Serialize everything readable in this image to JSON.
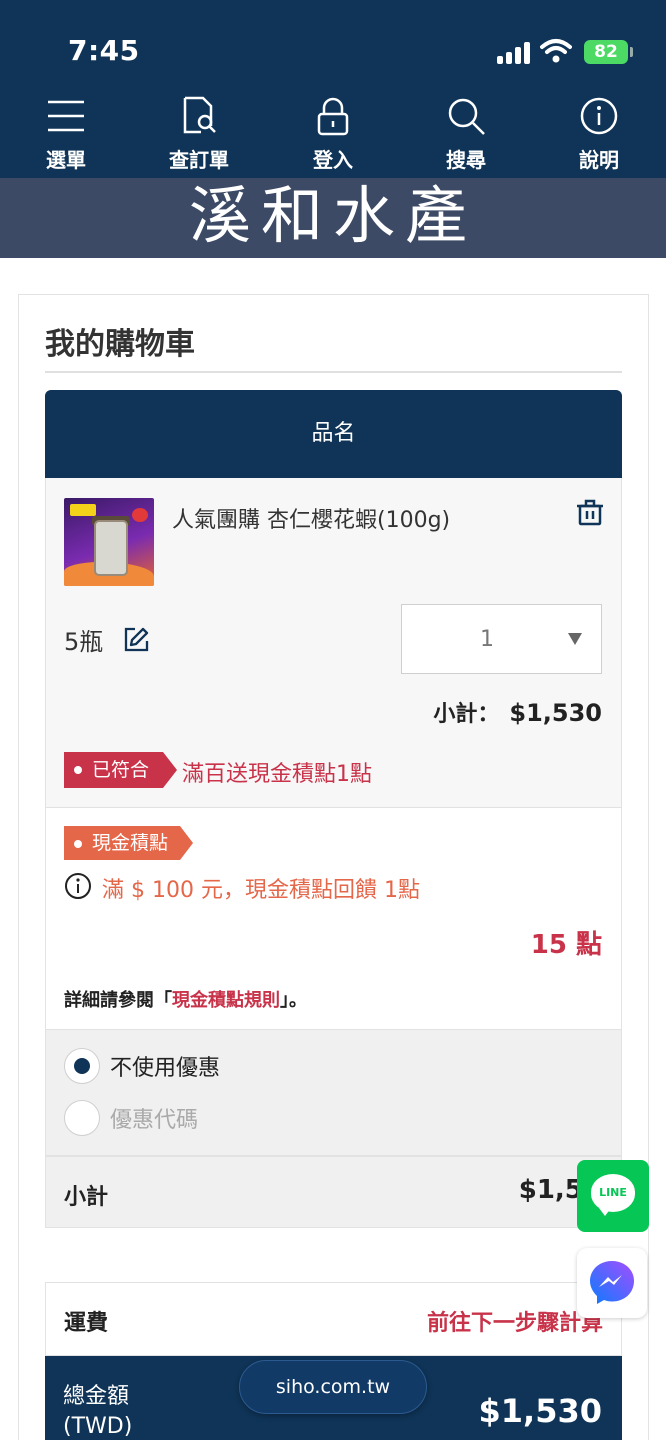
{
  "status_bar": {
    "time": "7:45",
    "battery": "82"
  },
  "nav": {
    "items": [
      {
        "label": "選單",
        "icon": "menu-icon"
      },
      {
        "label": "查訂單",
        "icon": "order-search-icon"
      },
      {
        "label": "登入",
        "icon": "lock-icon"
      },
      {
        "label": "搜尋",
        "icon": "search-icon"
      },
      {
        "label": "說明",
        "icon": "info-icon"
      }
    ]
  },
  "banner": {
    "title": "溪和水產"
  },
  "cart": {
    "title": "我的購物車",
    "column_header": "品名",
    "item": {
      "name": "人氣團購 杏仁櫻花蝦(100g)",
      "variant": "5瓶",
      "quantity": "1",
      "subtotal_label": "小計：",
      "subtotal_value": "$1,530",
      "qualified_badge": "已符合",
      "promo_text": "滿百送現金積點1點"
    },
    "points": {
      "badge": "現金積點",
      "rule": "滿 $ 100 元，現金積點回饋 1點",
      "value": "15 點",
      "detail_prefix": "詳細請參閱「",
      "detail_link": "現金積點規則",
      "detail_suffix": "」。"
    },
    "coupon": {
      "options": [
        {
          "label": "不使用優惠",
          "selected": true
        },
        {
          "label": "優惠代碼",
          "selected": false
        }
      ]
    },
    "subtotal": {
      "label": "小計",
      "value": "$1,53"
    },
    "shipping": {
      "label": "運費",
      "value": "前往下一步驟計算"
    },
    "total": {
      "label": "總金額 (TWD)",
      "value": "$1,530"
    }
  },
  "url_bar": {
    "domain": "siho.com.tw"
  },
  "floating": {
    "line_label": "LINE"
  },
  "colors": {
    "navy": "#0f3457",
    "accent_red": "#c8334a",
    "points_orange": "#e5674a",
    "line_green": "#06c755"
  }
}
